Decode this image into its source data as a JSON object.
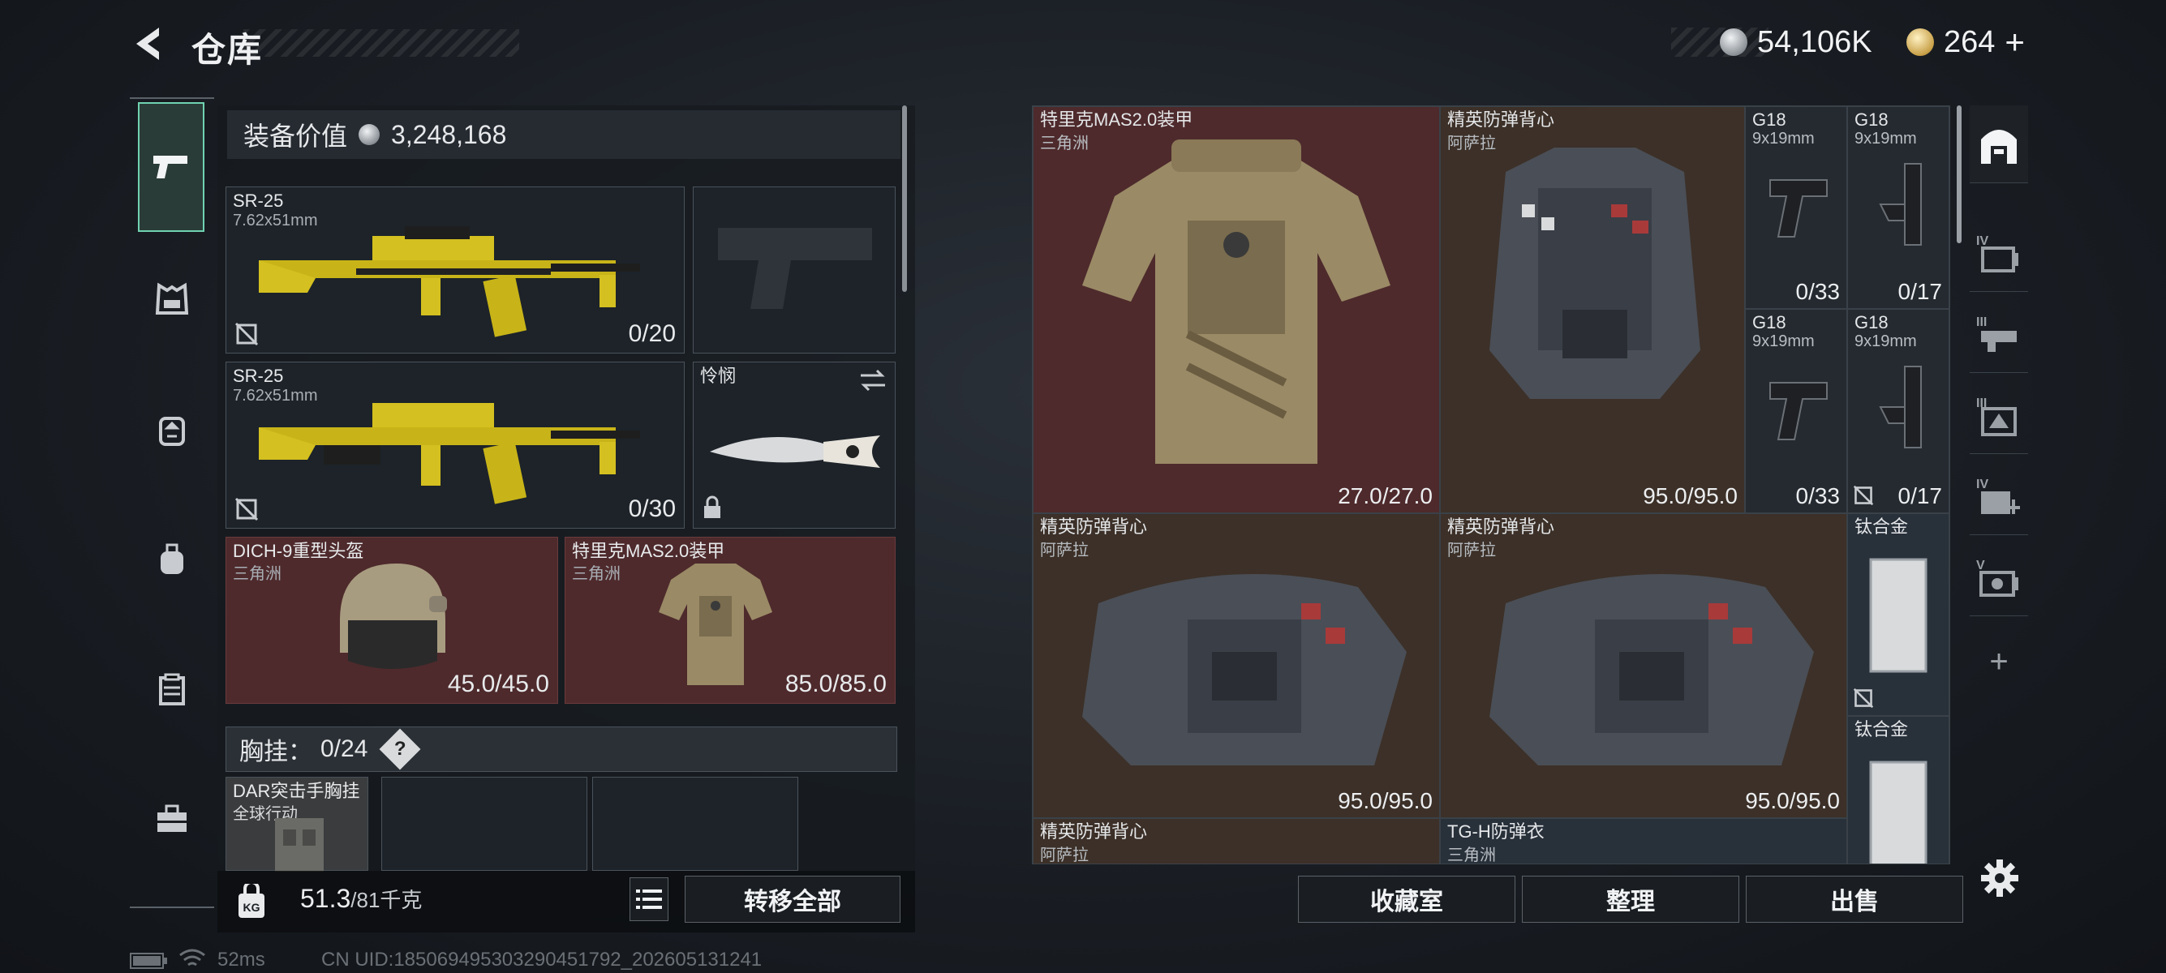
{
  "header": {
    "title": "仓库",
    "currency_1": "54,106K",
    "currency_2": "264",
    "add_symbol": "+"
  },
  "left_panel": {
    "equip_value_label": "装备价值",
    "equip_value": "3,248,168",
    "slots": [
      {
        "name": "SR-25",
        "caliber": "7.62x51mm",
        "count": "0/20"
      },
      {
        "name": "SR-25",
        "caliber": "7.62x51mm",
        "count": "0/30"
      },
      {
        "name": "怜悯"
      },
      {
        "name": "DICH-9重型头盔",
        "sub": "三角洲",
        "count": "45.0/45.0"
      },
      {
        "name": "特里克MAS2.0装甲",
        "sub": "三角洲",
        "count": "85.0/85.0"
      }
    ],
    "chest_rig_label": "胸挂：",
    "chest_rig_count": "0/24",
    "chest_rig_help": "?",
    "chest_rig_item": {
      "name": "DAR突击手胸挂",
      "sub": "全球行动"
    },
    "weight": "51.3",
    "weight_max": "/81千克",
    "transfer_all": "转移全部"
  },
  "stash": {
    "items": [
      {
        "name": "特里克MAS2.0装甲",
        "sub": "三角洲",
        "count": "27.0/27.0"
      },
      {
        "name": "精英防弹背心",
        "sub": "阿萨拉",
        "count": "95.0/95.0"
      },
      {
        "name": "G18",
        "sub": "9x19mm",
        "count": "0/33"
      },
      {
        "name": "G18",
        "sub": "9x19mm",
        "count": "0/17"
      },
      {
        "name": "G18",
        "sub": "9x19mm",
        "count": "0/33"
      },
      {
        "name": "G18",
        "sub": "9x19mm",
        "count": "0/17"
      },
      {
        "name": "精英防弹背心",
        "sub": "阿萨拉",
        "count": "95.0/95.0"
      },
      {
        "name": "精英防弹背心",
        "sub": "阿萨拉",
        "count": "95.0/95.0"
      },
      {
        "name": "钛合金"
      },
      {
        "name": "钛合金"
      },
      {
        "name": "精英防弹背心",
        "sub": "阿萨拉"
      },
      {
        "name": "TG-H防弹衣",
        "sub": "三角洲"
      }
    ],
    "btn_collection": "收藏室",
    "btn_sort": "整理",
    "btn_sell": "出售"
  },
  "right_rail": {
    "labels": [
      "IV",
      "III",
      "III",
      "IV",
      "V"
    ],
    "add": "+"
  },
  "status_bar": {
    "ping": "52ms",
    "uid": "CN UID:185069495303290451792_202605131241"
  },
  "colors": {
    "accent": "#6fd2b0",
    "red_slot": "#4e2a2c",
    "brown_slot": "#3c3028",
    "gold_weapon": "#d4c020"
  }
}
